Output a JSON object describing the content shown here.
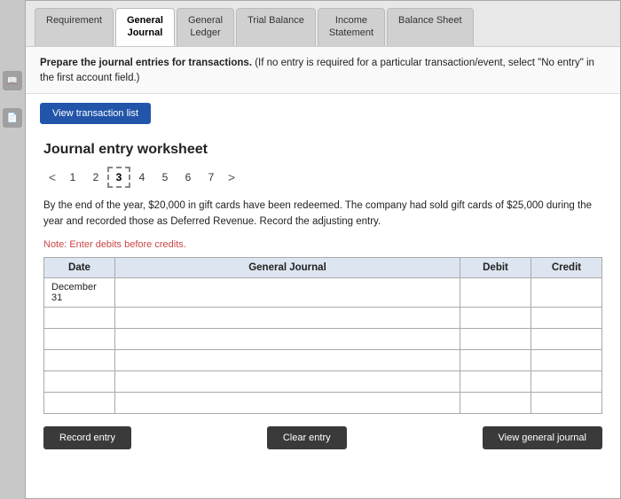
{
  "tabs": [
    {
      "label": "Requirement",
      "active": false
    },
    {
      "label": "General\nJournal",
      "active": true
    },
    {
      "label": "General\nLedger",
      "active": false
    },
    {
      "label": "Trial Balance",
      "active": false
    },
    {
      "label": "Income\nStatement",
      "active": false
    },
    {
      "label": "Balance Sheet",
      "active": false
    }
  ],
  "instructions": {
    "text": "Prepare the journal entries for transactions. (If no entry is required for a particular transaction/event, select \"No entry\" in the first account field.)"
  },
  "view_transaction_btn": "View transaction list",
  "worksheet": {
    "title": "Journal entry worksheet",
    "pages": [
      "1",
      "2",
      "3",
      "4",
      "5",
      "6",
      "7"
    ],
    "active_page": "3",
    "description": "By the end of the year, $20,000 in gift cards have been redeemed. The company had sold gift cards of $25,000 during the year and recorded those as Deferred Revenue. Record the adjusting entry.",
    "note": "Note: Enter debits before credits.",
    "table": {
      "headers": [
        "Date",
        "General Journal",
        "Debit",
        "Credit"
      ],
      "rows": [
        {
          "date": "December\n31",
          "desc": "",
          "debit": "",
          "credit": ""
        },
        {
          "date": "",
          "desc": "",
          "debit": "",
          "credit": ""
        },
        {
          "date": "",
          "desc": "",
          "debit": "",
          "credit": ""
        },
        {
          "date": "",
          "desc": "",
          "debit": "",
          "credit": ""
        },
        {
          "date": "",
          "desc": "",
          "debit": "",
          "credit": ""
        },
        {
          "date": "",
          "desc": "",
          "debit": "",
          "credit": ""
        }
      ]
    }
  },
  "buttons": {
    "record_entry": "Record entry",
    "clear_entry": "Clear entry",
    "view_general_journal": "View general journal"
  },
  "sidebar": {
    "icon1": "book",
    "icon2": "doc"
  }
}
